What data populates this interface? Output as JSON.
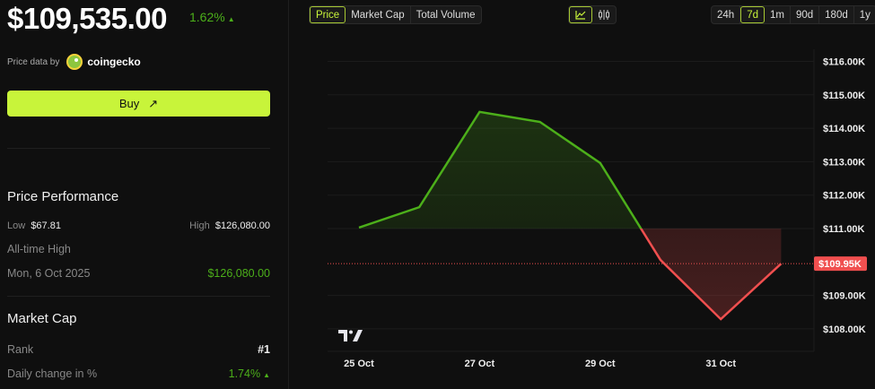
{
  "header": {
    "price": "$109,535.00",
    "change": "1.62%",
    "change_arrow": "▲"
  },
  "source": {
    "label": "Price data by",
    "name": "coingecko"
  },
  "buy": {
    "label": "Buy",
    "icon": "arrow-up-right-icon"
  },
  "performance": {
    "title": "Price Performance",
    "low_label": "Low",
    "low": "$67.81",
    "high_label": "High",
    "high": "$126,080.00",
    "ath_label": "All-time High",
    "ath_date": "Mon, 6 Oct 2025",
    "ath_value": "$126,080.00"
  },
  "market_cap": {
    "title": "Market Cap",
    "rank_label": "Rank",
    "rank": "#1",
    "daily_label": "Daily change in %",
    "daily": "1.74%",
    "daily_arrow": "▲"
  },
  "metric_tabs": [
    "Price",
    "Market Cap",
    "Total Volume"
  ],
  "active_metric": "Price",
  "chart_type_toggle": [
    "line-chart-icon",
    "candlestick-icon"
  ],
  "range_tabs": [
    "24h",
    "7d",
    "1m",
    "90d",
    "180d",
    "1y"
  ],
  "active_range": "7d",
  "colors": {
    "accent": "#c8f43a",
    "up": "#4caf1a",
    "down": "#f04f4f"
  },
  "chart_data": {
    "type": "area",
    "x": [
      "25 Oct",
      "26 Oct",
      "27 Oct",
      "28 Oct",
      "29 Oct",
      "30 Oct",
      "31 Oct",
      "1 Nov"
    ],
    "values": [
      111030,
      111640,
      114490,
      114190,
      112960,
      110060,
      108290,
      109950
    ],
    "baseline": 111000,
    "xtick_labels": [
      "25 Oct",
      "27 Oct",
      "29 Oct",
      "31 Oct"
    ],
    "ytick_labels": [
      "$116.00K",
      "$115.00K",
      "$114.00K",
      "$113.00K",
      "$112.00K",
      "$111.00K",
      "$109.00K",
      "$108.00K"
    ],
    "ytick_values": [
      116000,
      115000,
      114000,
      113000,
      112000,
      111000,
      109000,
      108000
    ],
    "current_label": "$109.95K",
    "current_value": 109950,
    "grid": true
  }
}
